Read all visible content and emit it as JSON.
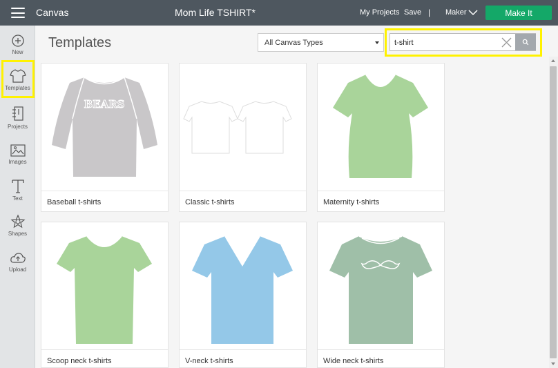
{
  "topbar": {
    "app_name": "Canvas",
    "document_title": "Mom Life TSHIRT*",
    "my_projects": "My Projects",
    "save": "Save",
    "separator": "|",
    "machine": "Maker",
    "make_it": "Make It",
    "make_it_color": "#14a868"
  },
  "sidebar": {
    "items": [
      {
        "label": "New",
        "icon": "plus-circle-icon"
      },
      {
        "label": "Templates",
        "icon": "tshirt-icon"
      },
      {
        "label": "Projects",
        "icon": "notebook-icon"
      },
      {
        "label": "Images",
        "icon": "image-icon"
      },
      {
        "label": "Text",
        "icon": "text-icon"
      },
      {
        "label": "Shapes",
        "icon": "shapes-icon"
      },
      {
        "label": "Upload",
        "icon": "cloud-upload-icon"
      }
    ],
    "selected": "Templates"
  },
  "main": {
    "title": "Templates",
    "canvas_type_select": "All Canvas Types",
    "search_value": "t-shirt"
  },
  "templates": [
    {
      "label": "Baseball t-shirts",
      "shirt_color": "#c9c7c9",
      "print": "BEARS"
    },
    {
      "label": "Classic t-shirts",
      "shirt_color": "#ffffff"
    },
    {
      "label": "Maternity t-shirts",
      "shirt_color": "#a9d49a"
    },
    {
      "label": "Scoop neck t-shirts",
      "shirt_color": "#a9d49a"
    },
    {
      "label": "V-neck t-shirts",
      "shirt_color": "#94c8e8"
    },
    {
      "label": "Wide neck t-shirts",
      "shirt_color": "#9fbfa8"
    }
  ],
  "highlight_color": "#fff200"
}
